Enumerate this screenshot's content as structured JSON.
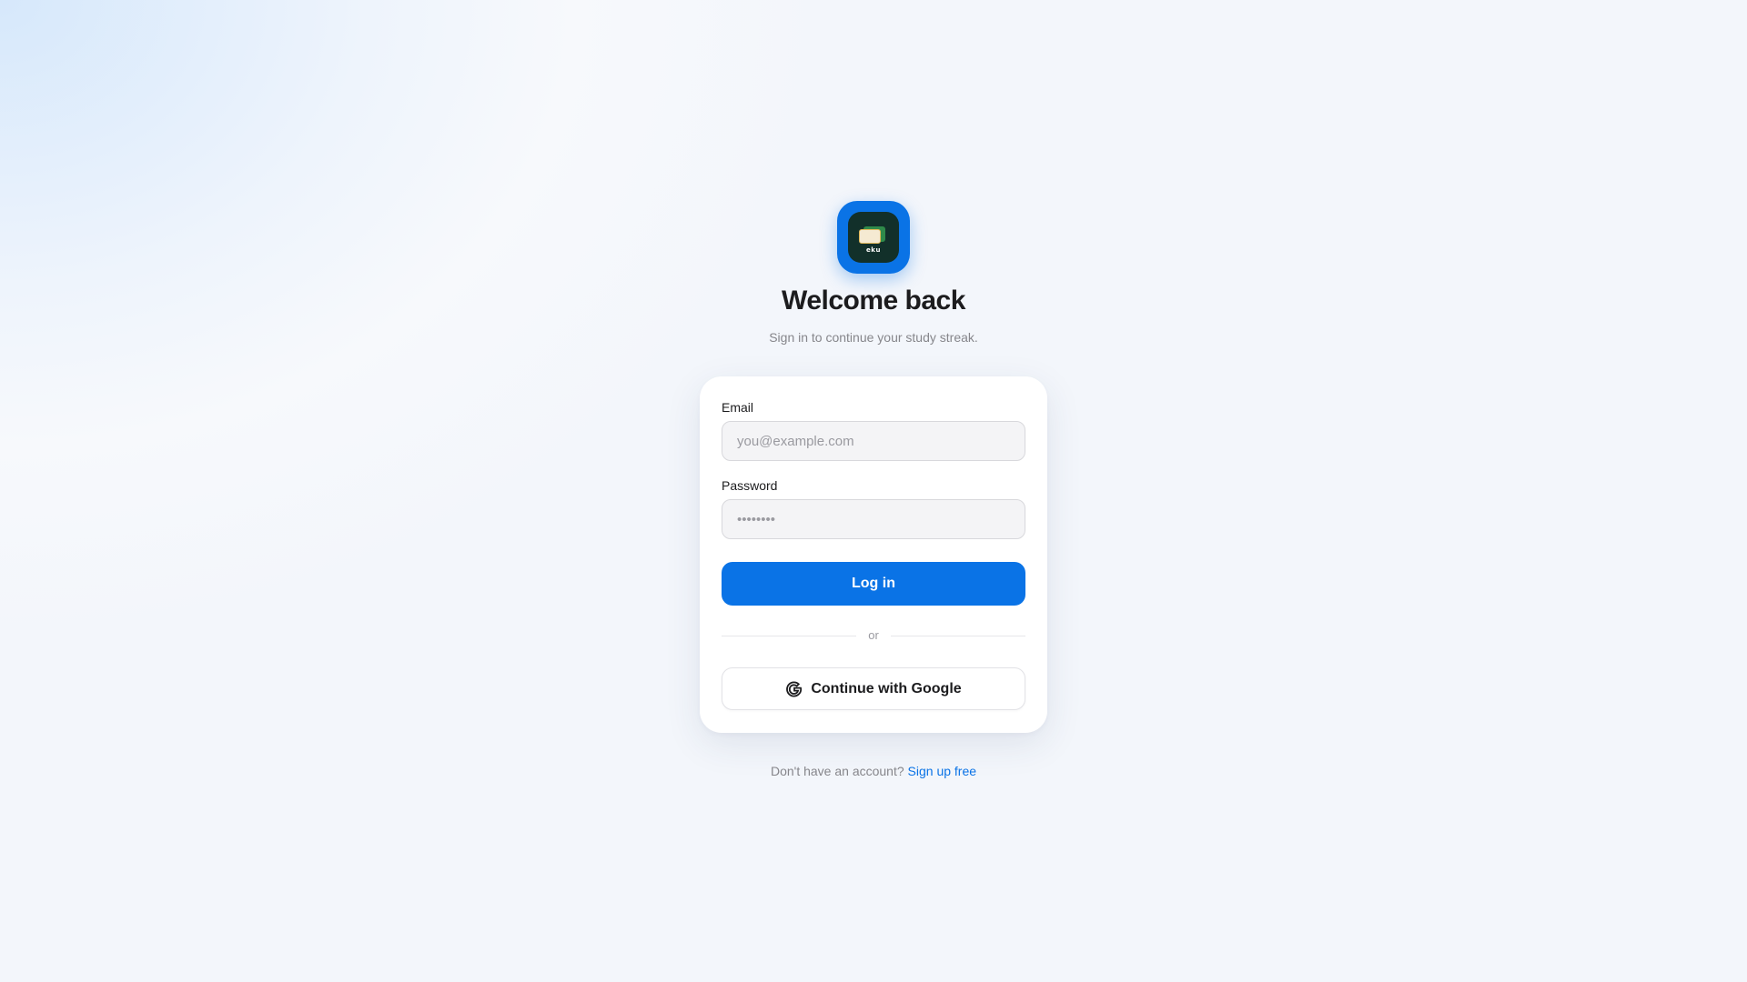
{
  "app": {
    "logo_text": "eku"
  },
  "header": {
    "title": "Welcome back",
    "subtitle": "Sign in to continue your study streak."
  },
  "form": {
    "email_label": "Email",
    "email_placeholder": "you@example.com",
    "email_value": "",
    "password_label": "Password",
    "password_placeholder": "••••••••",
    "password_value": "",
    "login_label": "Log in",
    "divider_text": "or",
    "google_label": "Continue with Google"
  },
  "footer": {
    "prompt": "Don't have an account?",
    "signup_link": "Sign up free"
  },
  "colors": {
    "accent": "#0a73e6",
    "text": "#1c1c1e",
    "muted": "#86868b"
  },
  "icons": {
    "logo": "flashcards-app-icon",
    "google": "google-icon"
  }
}
